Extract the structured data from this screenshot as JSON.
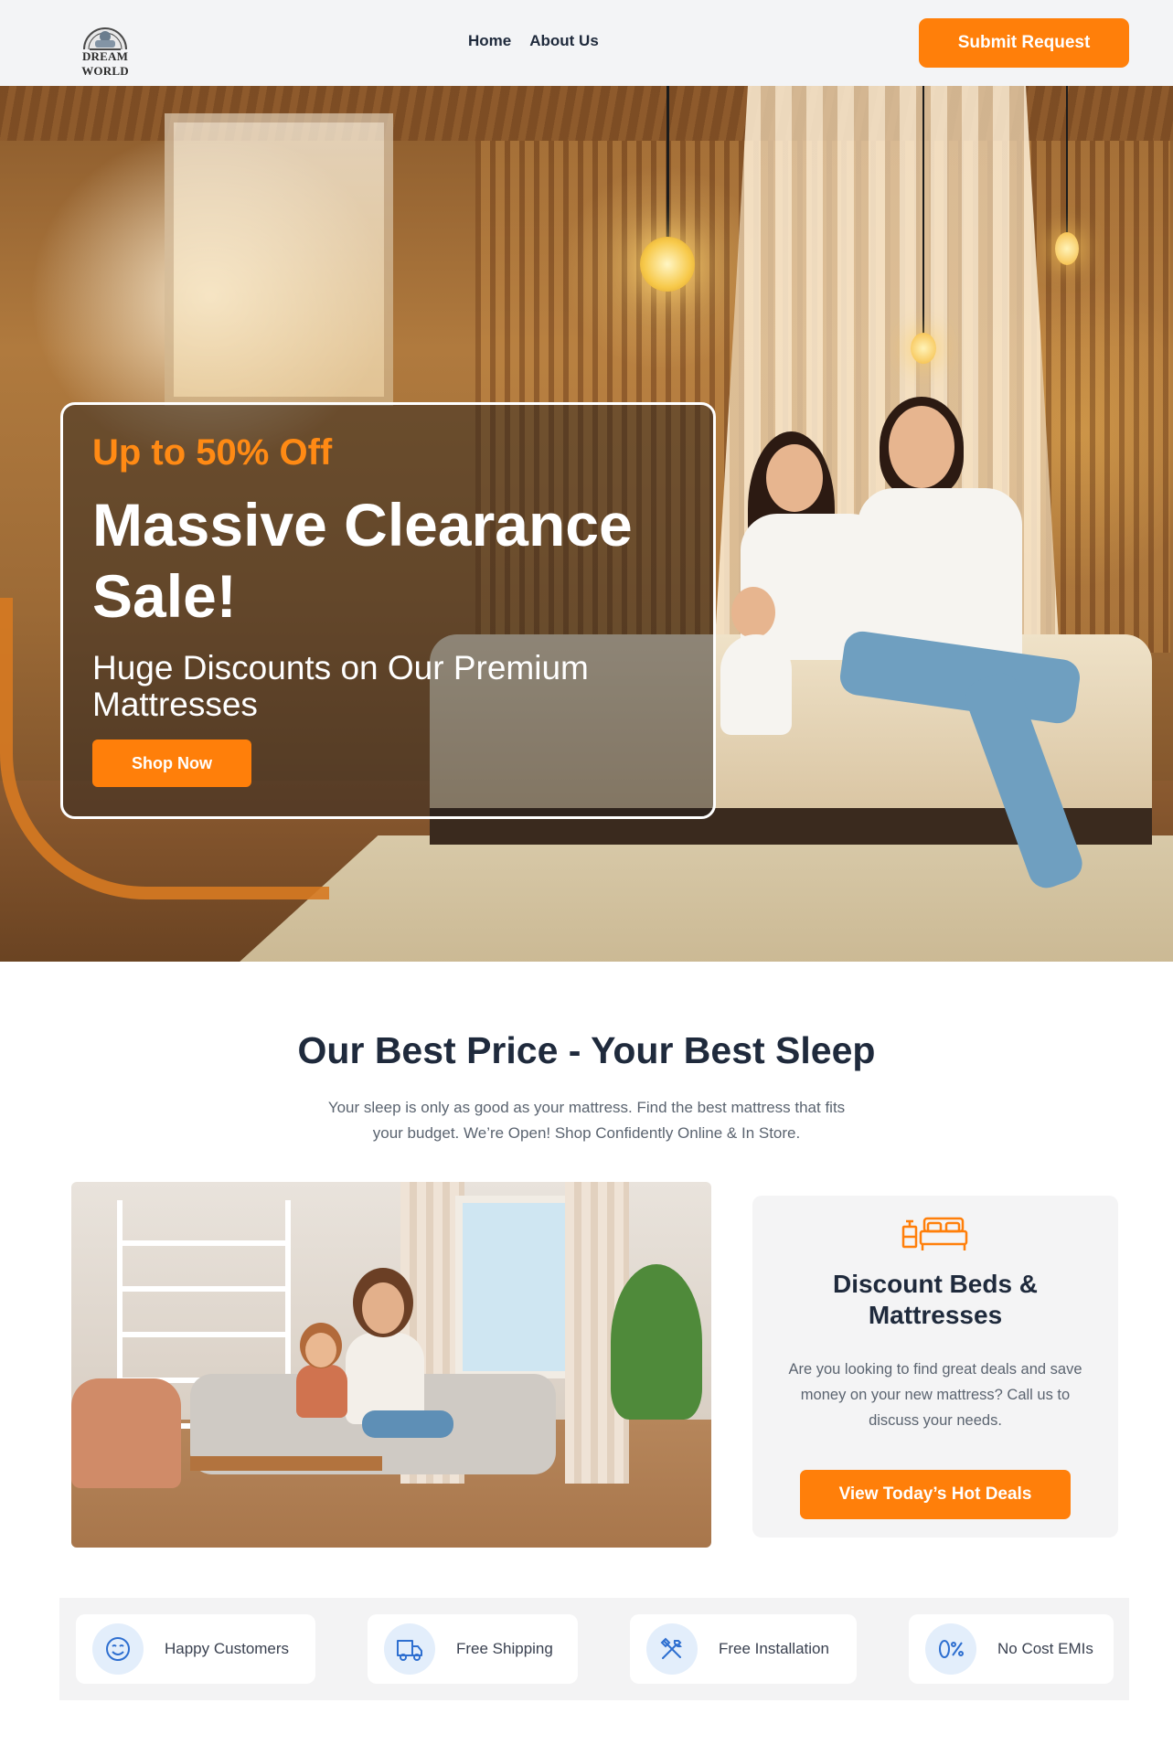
{
  "header": {
    "logo_text": "DREAM WORLD",
    "nav": [
      {
        "label": "Home"
      },
      {
        "label": "About Us"
      }
    ],
    "cta_label": "Submit Request"
  },
  "hero": {
    "eyebrow": "Up to 50% Off",
    "title": "Massive Clearance Sale!",
    "subtitle": "Huge Discounts on Our Premium Mattresses",
    "cta_label": "Shop Now"
  },
  "section": {
    "title": "Our Best Price - Your Best Sleep",
    "description": "Your sleep is only as good as your mattress. Find the best mattress that fits your budget. We’re Open! Shop Confidently Online & In Store."
  },
  "deal_card": {
    "icon": "bed-icon",
    "title": "Discount Beds & Mattresses",
    "text": "Are you looking to find great deals and save money on your new mattress? Call us to discuss your needs.",
    "cta_label": "View Today’s Hot Deals"
  },
  "features": [
    {
      "icon": "smile-icon",
      "label": "Happy Customers"
    },
    {
      "icon": "truck-icon",
      "label": "Free Shipping"
    },
    {
      "icon": "tools-icon",
      "label": "Free Installation"
    },
    {
      "icon": "zero-percent-icon",
      "label": "No Cost EMIs"
    }
  ],
  "colors": {
    "accent": "#ff7f0a",
    "text_dark": "#1f2a3c",
    "text_muted": "#5b6470",
    "icon_blue": "#2e6fd0"
  }
}
